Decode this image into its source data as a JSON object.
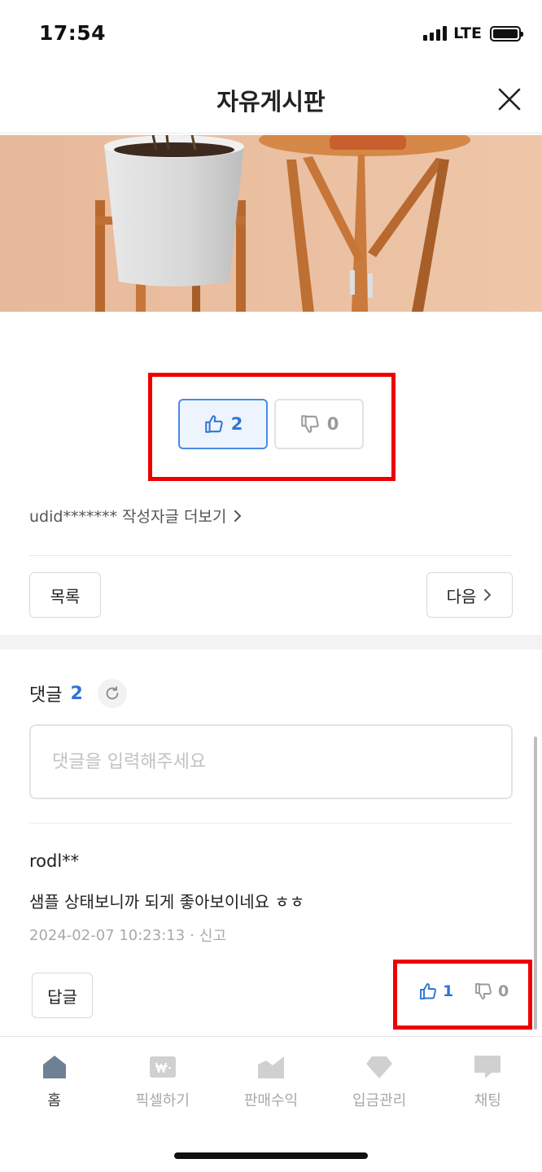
{
  "status_bar": {
    "time": "17:54",
    "network": "LTE"
  },
  "header": {
    "title": "자유게시판"
  },
  "post": {
    "likes": "2",
    "dislikes": "0",
    "author_more": "udid******* 작성자글 더보기",
    "list_label": "목록",
    "next_label": "다음"
  },
  "comments": {
    "label": "댓글",
    "count": "2",
    "input_placeholder": "댓글을 입력해주세요",
    "items": [
      {
        "author": "rodl**",
        "text": "샘플 상태보니까 되게 좋아보이네요 ㅎㅎ",
        "date": "2024-02-07 10:23:13",
        "separator": "·",
        "report_label": "신고",
        "reply_label": "답글",
        "likes": "1",
        "dislikes": "0"
      }
    ]
  },
  "tabbar": {
    "tabs": [
      {
        "label": "홈",
        "icon": "home-icon"
      },
      {
        "label": "픽셀하기",
        "icon": "won-icon"
      },
      {
        "label": "판매수익",
        "icon": "chart-icon"
      },
      {
        "label": "입금관리",
        "icon": "diamond-icon"
      },
      {
        "label": "채팅",
        "icon": "chat-icon"
      }
    ]
  },
  "colors": {
    "accent_blue": "#2f74d4",
    "highlight_red": "#ee0000",
    "tab_icon_active": "#6e8194",
    "tab_icon_inactive": "#d0d0d0"
  }
}
